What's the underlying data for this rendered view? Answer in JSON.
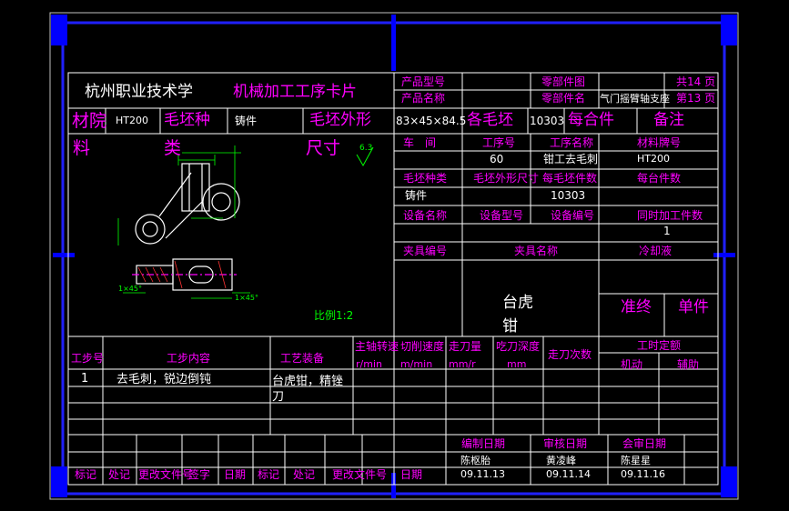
{
  "header": {
    "school": "杭州职业技术学",
    "title": "机械加工工序卡片",
    "labels": {
      "product_model": "产品型号",
      "product_name": "产品名称",
      "part_drawing": "零部件图",
      "part_name": "零部件名",
      "total_label": "共14 页",
      "page_label": "第13 页"
    },
    "part_name_value": "气门摇臂轴支座"
  },
  "material_row": {
    "label_a": "材院",
    "material_value": "HT200",
    "blank_type_label": "毛坯种",
    "blank_type_value": "铸件",
    "blank_size_label": "毛坯外形",
    "blank_size_value": "83×45×84.5",
    "each_blank_label": "各毛坯",
    "count_value": "10303",
    "per_unit_label": "每合件",
    "remark_label": "备注"
  },
  "left_col": {
    "liao": "料",
    "lei": "类",
    "chicun": "尺寸",
    "roughness": "6.3"
  },
  "drawing": {
    "scale": "比例1:2",
    "note_1": "1×45°",
    "note_2": "1×45°"
  },
  "info_table": {
    "workshop_label": "车　间",
    "process_no_label": "工序号",
    "process_name_label": "工序名称",
    "material_grade_label": "材料牌号",
    "process_no_value": "60",
    "process_name_value": "钳工去毛刺",
    "material_grade_value": "HT200",
    "blank_kind_label": "毛坯种类",
    "blank_dims_label": "毛坯外形尺寸",
    "per_blank_label": "每毛坯件数",
    "per_unit_count_label": "每台件数",
    "blank_kind_value": "铸件",
    "per_blank_value": "10303",
    "equip_name_label": "设备名称",
    "equip_model_label": "设备型号",
    "equip_no_label": "设备编号",
    "simul_label": "同时加工件数",
    "simul_value": "1",
    "fixture_no_label": "夹具编号",
    "fixture_name_label": "夹具名称",
    "coolant_label": "冷却液",
    "fixture_value": "台虎钳",
    "prep_label": "准终",
    "unit_label": "单件"
  },
  "steps_table": {
    "headers": {
      "step_no": "工步号",
      "step_content": "工步内容",
      "equipment": "工艺装备",
      "spindle_speed": "主轴转速",
      "cut_speed": "切削速度",
      "feed": "走刀量",
      "depth": "吃刀深度",
      "passes": "走刀次数",
      "time_quota": "工时定额",
      "machine": "机动",
      "aux": "辅助"
    },
    "units": {
      "spindle": "r/min",
      "speed": "m/min",
      "feed": "mm/r",
      "depth": "mm"
    },
    "rows": [
      {
        "no": "1",
        "content": "去毛刺，锐边倒钝",
        "equipment": "台虎钳，精锉刀"
      }
    ]
  },
  "footer": {
    "labels": [
      "标记",
      "处记",
      "更改文件号",
      "签字",
      "日期",
      "标记",
      "处记",
      "更改文件号",
      "日期"
    ],
    "compile_label": "编制日期",
    "review_label": "审核日期",
    "sign_label": "会审日期",
    "compiler": "陈枢胎",
    "compile_date": "09.11.13",
    "reviewer": "黄凌峰",
    "review_date": "09.11.14",
    "signer": "陈星星",
    "sign_date": "09.11.16"
  }
}
